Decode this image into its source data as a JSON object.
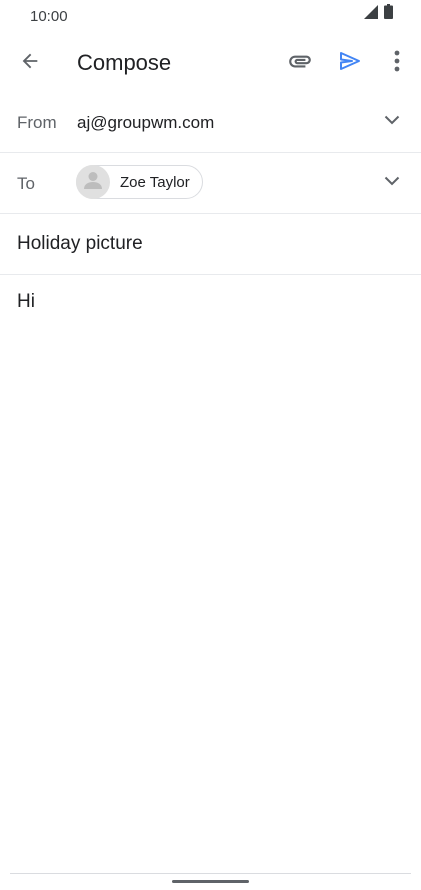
{
  "status_bar": {
    "time": "10:00",
    "icons": [
      "signal-icon",
      "battery-icon"
    ]
  },
  "app_bar": {
    "title": "Compose",
    "icons": [
      "back-arrow-icon",
      "paperclip-icon",
      "send-icon",
      "more-vert-icon"
    ],
    "accent_color": "#4285f4"
  },
  "compose": {
    "from_label": "From",
    "from_value": "aj@groupwm.com",
    "to_label": "To",
    "recipients": [
      {
        "name": "Zoe Taylor",
        "avatar_icon": "person-icon"
      }
    ],
    "subject": "Holiday picture",
    "body": "Hi"
  }
}
